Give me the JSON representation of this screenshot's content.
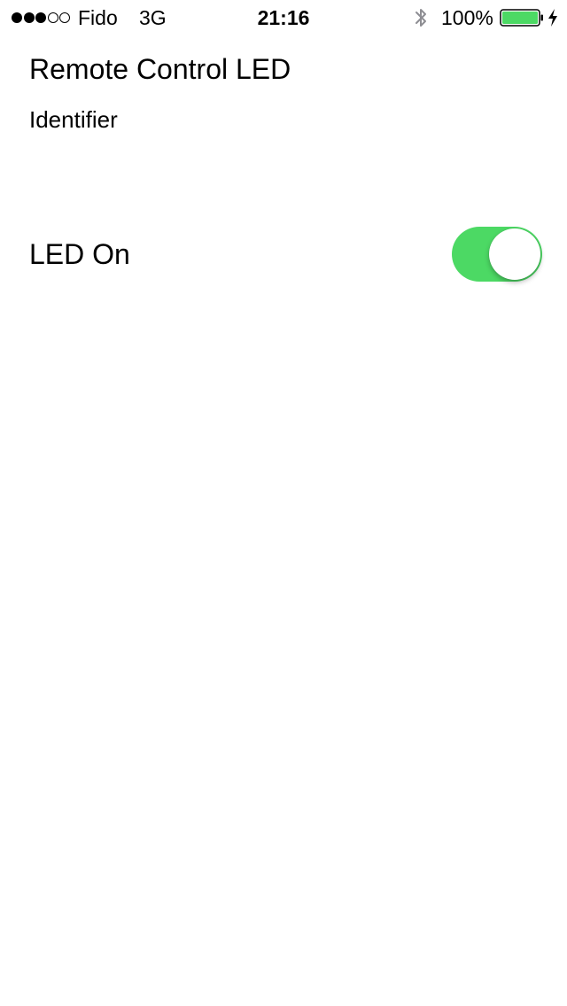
{
  "status_bar": {
    "signal_bars_filled": 3,
    "signal_bars_total": 5,
    "carrier": "Fido",
    "network": "3G",
    "time": "21:16",
    "bluetooth_icon": "bluetooth-icon",
    "battery_percent": "100%",
    "battery_level": 1.0,
    "battery_color": "#4cd964",
    "charging_icon": "lightning-bolt-icon"
  },
  "screen": {
    "title": "Remote Control LED",
    "identifier": "Identifier",
    "led_toggle": {
      "label": "LED On",
      "on": true,
      "on_color": "#4cd964"
    }
  }
}
